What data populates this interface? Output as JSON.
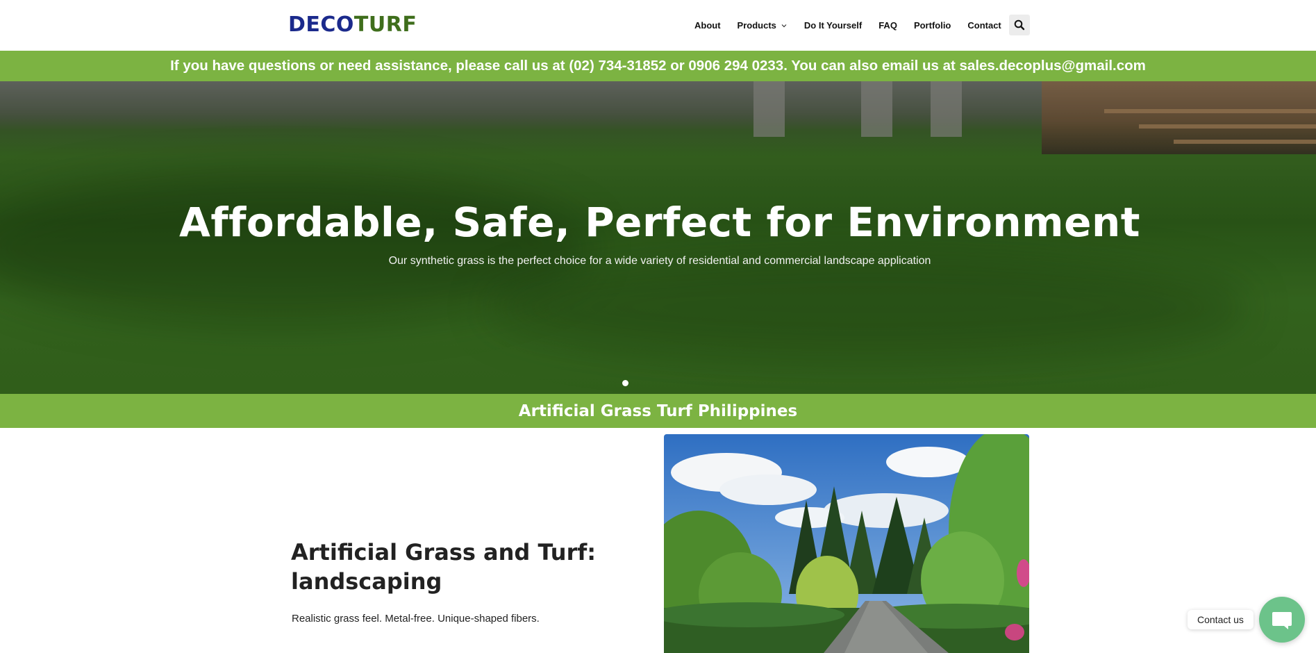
{
  "brand": {
    "logo_part1": "DECO",
    "logo_part2": "TURF",
    "logo_colors": {
      "deco": "#1b2a8c",
      "turf": "#3f6e1c"
    }
  },
  "nav": {
    "items": [
      {
        "label": "About"
      },
      {
        "label": "Products",
        "has_dropdown": true
      },
      {
        "label": "Do It Yourself"
      },
      {
        "label": "FAQ"
      },
      {
        "label": "Portfolio"
      },
      {
        "label": "Contact"
      }
    ],
    "search_icon": "search-icon"
  },
  "notice": {
    "text": "If you have questions or need assistance, please call us at (02) 734-31852 or 0906 294 0233. You can also email us at sales.decoplus@gmail.com"
  },
  "hero": {
    "title": "Affordable, Safe, Perfect for Environment",
    "subtitle": "Our synthetic grass is the perfect choice for a wide variety of residential and commercial landscape application",
    "slide_count": 1,
    "active_slide": 1
  },
  "section_band": {
    "title": "Artificial Grass Turf Philippines"
  },
  "content": {
    "heading": "Artificial Grass and Turf: landscaping",
    "text": "Realistic grass feel. Metal-free. Unique-shaped fibers."
  },
  "contact_widget": {
    "label": "Contact us",
    "icon": "chat-bubble-icon"
  },
  "colors": {
    "accent_green": "#7cb342",
    "widget_green": "#6cc38a",
    "text_dark": "#222222"
  }
}
